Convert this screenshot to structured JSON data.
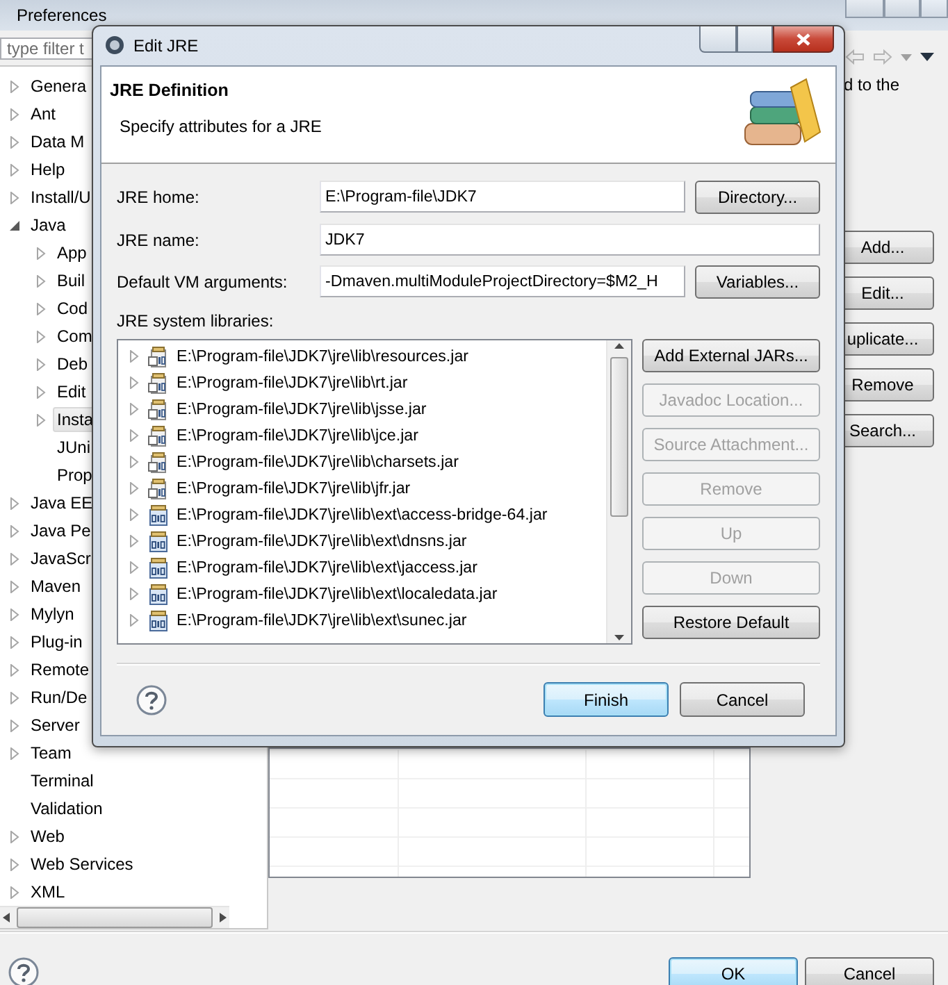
{
  "preferences": {
    "title": "Preferences",
    "filter": {
      "placeholder": "type filter t"
    },
    "tree": [
      {
        "label": "Genera",
        "kind": "collapsed",
        "selected": false
      },
      {
        "label": "Ant",
        "kind": "collapsed",
        "selected": false
      },
      {
        "label": "Data M",
        "kind": "collapsed",
        "selected": false
      },
      {
        "label": "Help",
        "kind": "collapsed",
        "selected": false
      },
      {
        "label": "Install/U",
        "kind": "collapsed",
        "selected": false
      },
      {
        "label": "Java",
        "kind": "expanded",
        "selected": false,
        "children": [
          {
            "label": "App",
            "kind": "collapsed",
            "selected": false
          },
          {
            "label": "Buil",
            "kind": "collapsed",
            "selected": false
          },
          {
            "label": "Cod",
            "kind": "collapsed",
            "selected": false
          },
          {
            "label": "Com",
            "kind": "collapsed",
            "selected": false
          },
          {
            "label": "Deb",
            "kind": "collapsed",
            "selected": false
          },
          {
            "label": "Edit",
            "kind": "collapsed",
            "selected": false
          },
          {
            "label": "Insta",
            "kind": "collapsed",
            "selected": true
          },
          {
            "label": "JUni",
            "kind": "leaf",
            "selected": false
          },
          {
            "label": "Prop",
            "kind": "leaf",
            "selected": false
          }
        ]
      },
      {
        "label": "Java EE",
        "kind": "collapsed",
        "selected": false
      },
      {
        "label": "Java Pe",
        "kind": "collapsed",
        "selected": false
      },
      {
        "label": "JavaScr",
        "kind": "collapsed",
        "selected": false
      },
      {
        "label": "Maven",
        "kind": "collapsed",
        "selected": false
      },
      {
        "label": "Mylyn",
        "kind": "collapsed",
        "selected": false
      },
      {
        "label": "Plug-in",
        "kind": "collapsed",
        "selected": false
      },
      {
        "label": "Remote",
        "kind": "collapsed",
        "selected": false
      },
      {
        "label": "Run/De",
        "kind": "collapsed",
        "selected": false
      },
      {
        "label": "Server",
        "kind": "collapsed",
        "selected": false
      },
      {
        "label": "Team",
        "kind": "collapsed",
        "selected": false
      },
      {
        "label": "Terminal",
        "kind": "leaf",
        "selected": false
      },
      {
        "label": "Validation",
        "kind": "leaf",
        "selected": false
      },
      {
        "label": "Web",
        "kind": "collapsed",
        "selected": false
      },
      {
        "label": "Web Services",
        "kind": "collapsed",
        "selected": false
      },
      {
        "label": "XML",
        "kind": "collapsed",
        "selected": false
      }
    ],
    "description": "d to the",
    "side_buttons": [
      "Add...",
      "Edit...",
      "uplicate...",
      "Remove",
      "Search..."
    ],
    "buttons": [
      {
        "label": "OK",
        "default": true
      },
      {
        "label": "Cancel",
        "default": false
      }
    ]
  },
  "dialog": {
    "title": "Edit JRE",
    "heading": "JRE Definition",
    "subtitle": "Specify attributes for a JRE",
    "fields": [
      {
        "label": "JRE home:",
        "value": "E:\\Program-file\\JDK7",
        "button": "Directory..."
      },
      {
        "label": "JRE name:",
        "value": "JDK7"
      },
      {
        "label": "Default VM arguments:",
        "value": "-Dmaven.multiModuleProjectDirectory=$M2_H",
        "button": "Variables..."
      }
    ],
    "libraries_label": "JRE system libraries:",
    "libraries": [
      {
        "path": "E:\\Program-file\\JDK7\\jre\\lib\\resources.jar",
        "kind": "archive"
      },
      {
        "path": "E:\\Program-file\\JDK7\\jre\\lib\\rt.jar",
        "kind": "archive"
      },
      {
        "path": "E:\\Program-file\\JDK7\\jre\\lib\\jsse.jar",
        "kind": "archive"
      },
      {
        "path": "E:\\Program-file\\JDK7\\jre\\lib\\jce.jar",
        "kind": "archive"
      },
      {
        "path": "E:\\Program-file\\JDK7\\jre\\lib\\charsets.jar",
        "kind": "archive"
      },
      {
        "path": "E:\\Program-file\\JDK7\\jre\\lib\\jfr.jar",
        "kind": "archive"
      },
      {
        "path": "E:\\Program-file\\JDK7\\jre\\lib\\ext\\access-bridge-64.jar",
        "kind": "binary"
      },
      {
        "path": "E:\\Program-file\\JDK7\\jre\\lib\\ext\\dnsns.jar",
        "kind": "binary"
      },
      {
        "path": "E:\\Program-file\\JDK7\\jre\\lib\\ext\\jaccess.jar",
        "kind": "binary"
      },
      {
        "path": "E:\\Program-file\\JDK7\\jre\\lib\\ext\\localedata.jar",
        "kind": "binary"
      },
      {
        "path": "E:\\Program-file\\JDK7\\jre\\lib\\ext\\sunec.jar",
        "kind": "binary"
      }
    ],
    "library_buttons": [
      {
        "label": "Add External JARs...",
        "disabled": false
      },
      {
        "label": "Javadoc Location...",
        "disabled": true
      },
      {
        "label": "Source Attachment...",
        "disabled": true
      },
      {
        "label": "Remove",
        "disabled": true
      },
      {
        "label": "Up",
        "disabled": true
      },
      {
        "label": "Down",
        "disabled": true
      },
      {
        "label": "Restore Default",
        "disabled": false
      }
    ],
    "buttons": [
      {
        "label": "Finish",
        "default": true
      },
      {
        "label": "Cancel",
        "default": false
      }
    ]
  }
}
